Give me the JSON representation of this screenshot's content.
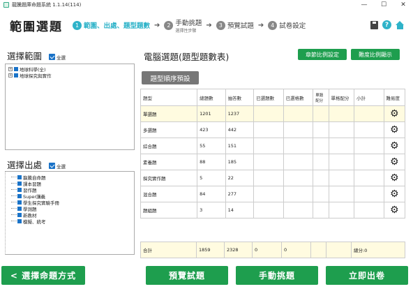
{
  "window": {
    "title": "龍騰題庫命題系統 1.1.14(114)",
    "minimize": "—",
    "maximize": "☐",
    "close": "✕"
  },
  "header": {
    "app_title": "範圍選題",
    "steps": [
      {
        "num": "1",
        "label": "範圍、出處、題型題數",
        "sub": ""
      },
      {
        "num": "2",
        "label": "手動挑題",
        "sub": "選擇性步驟"
      },
      {
        "num": "3",
        "label": "預覽試題",
        "sub": ""
      },
      {
        "num": "4",
        "label": "試卷設定",
        "sub": ""
      }
    ],
    "step_arrow": "➔",
    "help_label": "?"
  },
  "scope": {
    "title": "選擇範圍",
    "select_all": "全選",
    "items": [
      "地球科學(全)",
      "地球探究與實作"
    ]
  },
  "source": {
    "title": "選擇出處",
    "select_all": "全選",
    "items": [
      "龍騰自命題",
      "課本習題",
      "習作題",
      "Super講義",
      "學生探究實驗手冊",
      "學測題",
      "新教材",
      "模擬、統考"
    ]
  },
  "main": {
    "title": "電腦選題(題型題數表)",
    "chapter_ratio_btn": "章節比例設定",
    "difficulty_ratio_btn": "難度比例顯示",
    "type_order_btn": "題型順序預設",
    "columns": [
      "題型",
      "總題數",
      "抽答數",
      "已選題數",
      "已選格數",
      "單題配分",
      "單格配分",
      "小計",
      "難易度"
    ],
    "rows": [
      {
        "type": "單選題",
        "total": "1201",
        "answers": "1237",
        "highlight": true
      },
      {
        "type": "多選題",
        "total": "423",
        "answers": "442",
        "highlight": false
      },
      {
        "type": "綜合題",
        "total": "55",
        "answers": "151",
        "highlight": false
      },
      {
        "type": "素養題",
        "total": "88",
        "answers": "185",
        "highlight": false
      },
      {
        "type": "探究實作題",
        "total": "5",
        "answers": "22",
        "highlight": false
      },
      {
        "type": "混合題",
        "total": "84",
        "answers": "277",
        "highlight": false
      },
      {
        "type": "題組題",
        "total": "3",
        "answers": "14",
        "highlight": false
      }
    ],
    "gear_icon": "⚙",
    "totals": {
      "label": "合計",
      "total": "1859",
      "answers": "2328",
      "selected": "0",
      "cells": "0",
      "score": "總分:0"
    }
  },
  "footer": {
    "back_btn": "< 選擇命題方式",
    "preview_btn": "預覽試題",
    "manual_btn": "手動挑題",
    "publish_btn": "立即出卷"
  },
  "colors": {
    "accent": "#2fb3c9",
    "primary_green": "#1e9e4e",
    "highlight_row": "#fffbe0"
  }
}
